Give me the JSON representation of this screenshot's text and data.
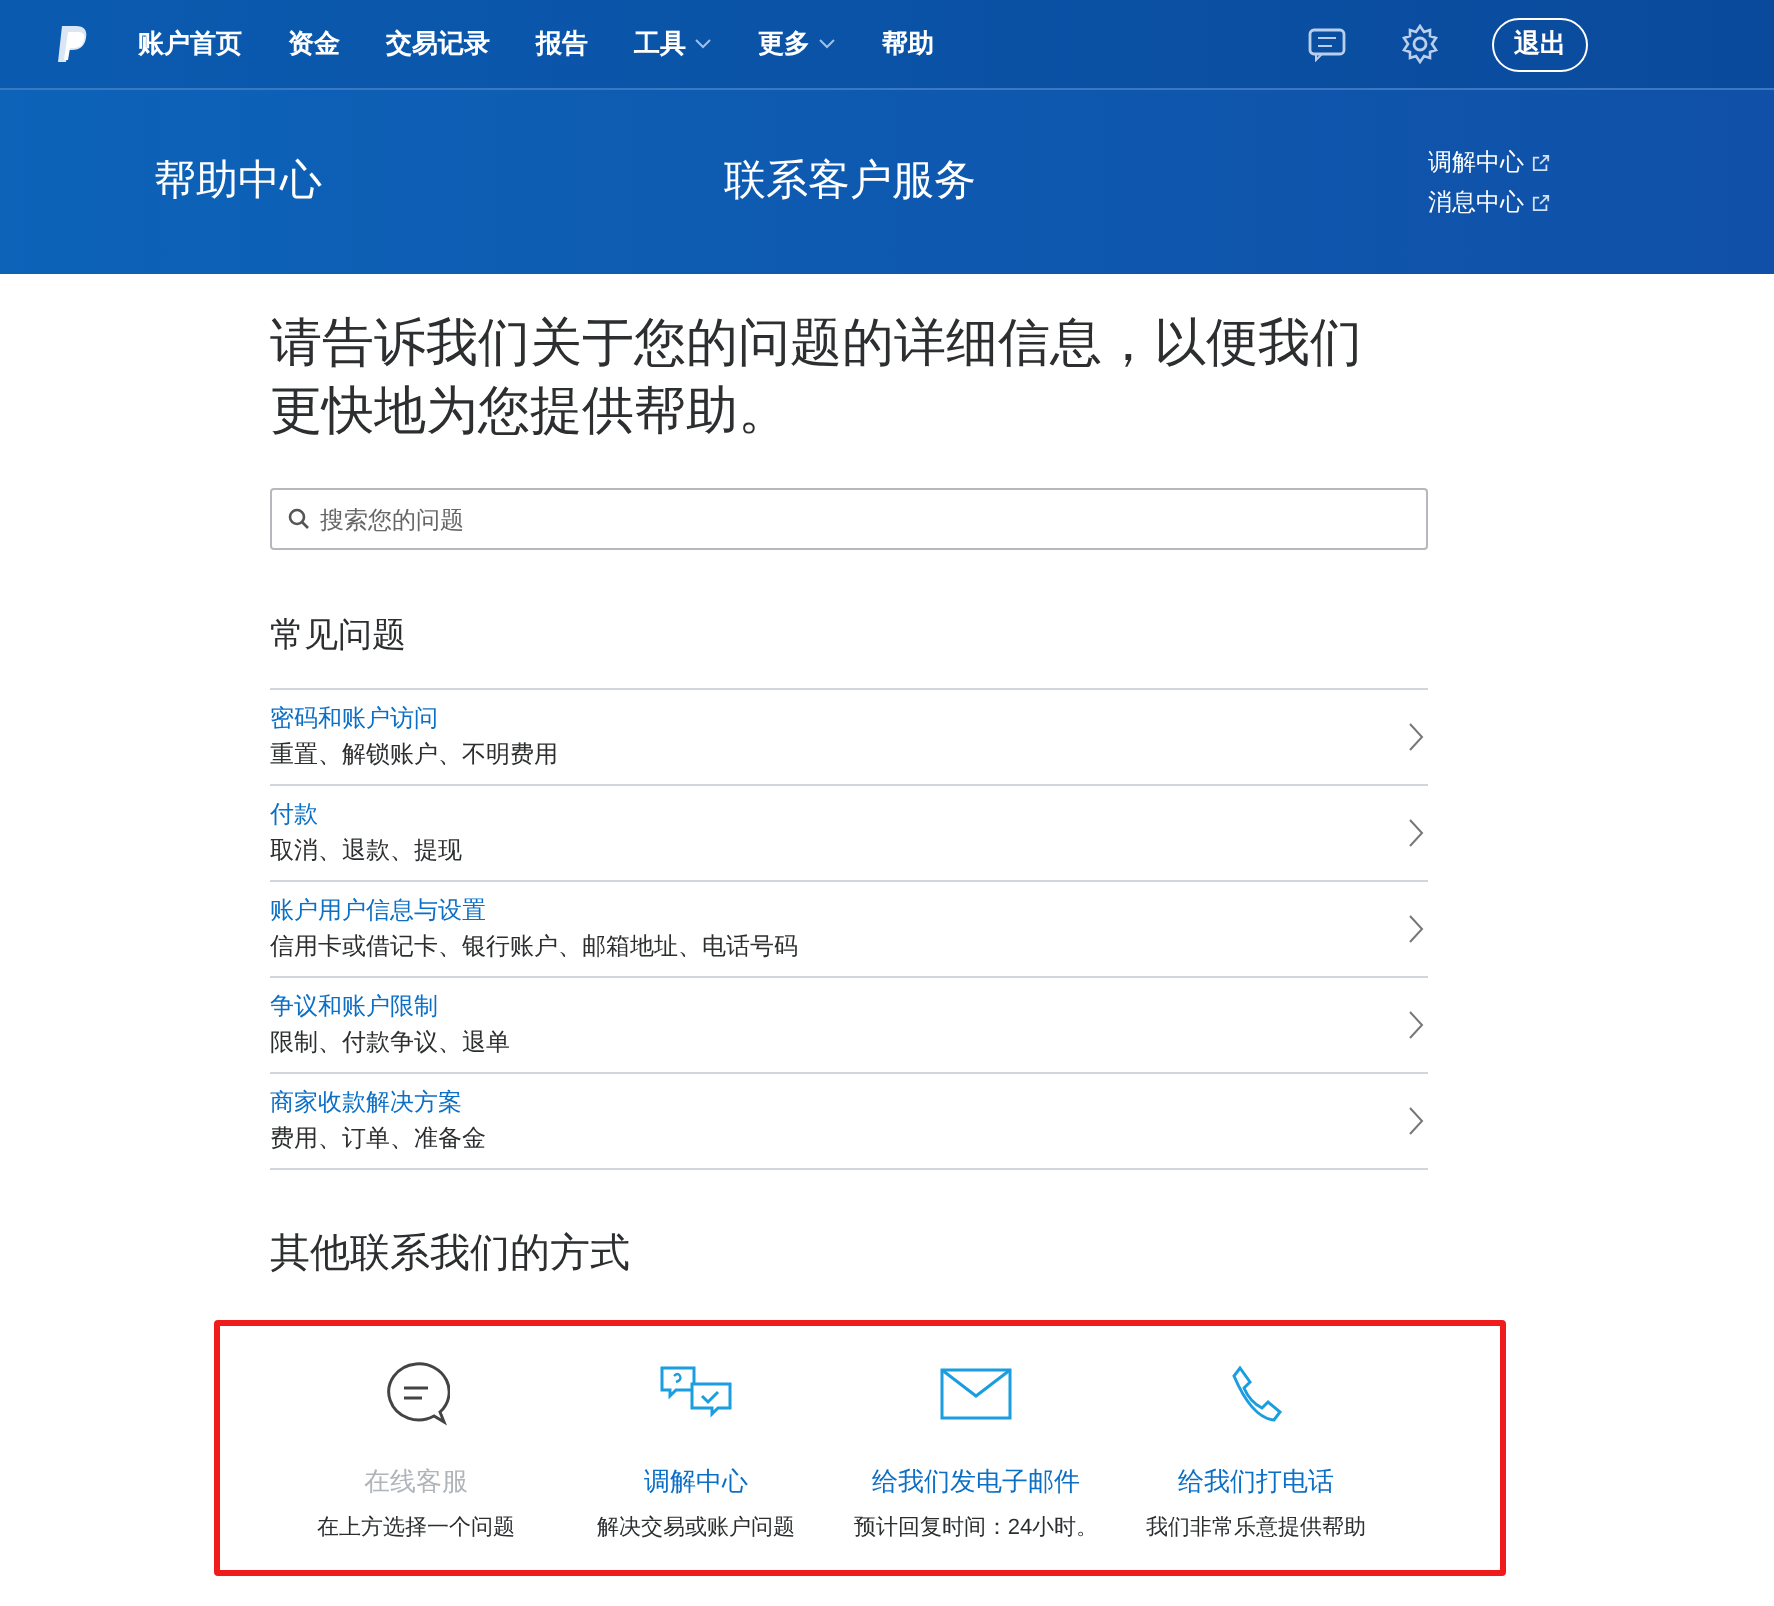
{
  "nav": {
    "items": [
      {
        "label": "账户首页",
        "has_menu": false
      },
      {
        "label": "资金",
        "has_menu": false
      },
      {
        "label": "交易记录",
        "has_menu": false
      },
      {
        "label": "报告",
        "has_menu": false
      },
      {
        "label": "工具",
        "has_menu": true
      },
      {
        "label": "更多",
        "has_menu": true
      },
      {
        "label": "帮助",
        "has_menu": false
      }
    ],
    "logout": "退出"
  },
  "banner": {
    "section": "帮助中心",
    "title": "联系客户服务",
    "links": [
      "调解中心",
      "消息中心"
    ]
  },
  "heading": "请告诉我们关于您的问题的详细信息，以便我们更快地为您提供帮助。",
  "search": {
    "placeholder": "搜索您的问题"
  },
  "faq": {
    "title": "常见问题",
    "items": [
      {
        "title": "密码和账户访问",
        "subtitle": "重置、解锁账户、不明费用"
      },
      {
        "title": "付款",
        "subtitle": "取消、退款、提现"
      },
      {
        "title": "账户用户信息与设置",
        "subtitle": "信用卡或借记卡、银行账户、邮箱地址、电话号码"
      },
      {
        "title": "争议和账户限制",
        "subtitle": "限制、付款争议、退单"
      },
      {
        "title": "商家收款解决方案",
        "subtitle": "费用、订单、准备金"
      }
    ]
  },
  "contact": {
    "title": "其他联系我们的方式",
    "options": [
      {
        "kind": "chat",
        "label": "在线客服",
        "note": "在上方选择一个问题",
        "disabled": true
      },
      {
        "kind": "resolution",
        "label": "调解中心",
        "note": "解决交易或账户问题",
        "disabled": false
      },
      {
        "kind": "email",
        "label": "给我们发电子邮件",
        "note": "预计回复时间：24小时。",
        "disabled": false
      },
      {
        "kind": "phone",
        "label": "给我们打电话",
        "note": "我们非常乐意提供帮助",
        "disabled": false
      }
    ]
  }
}
